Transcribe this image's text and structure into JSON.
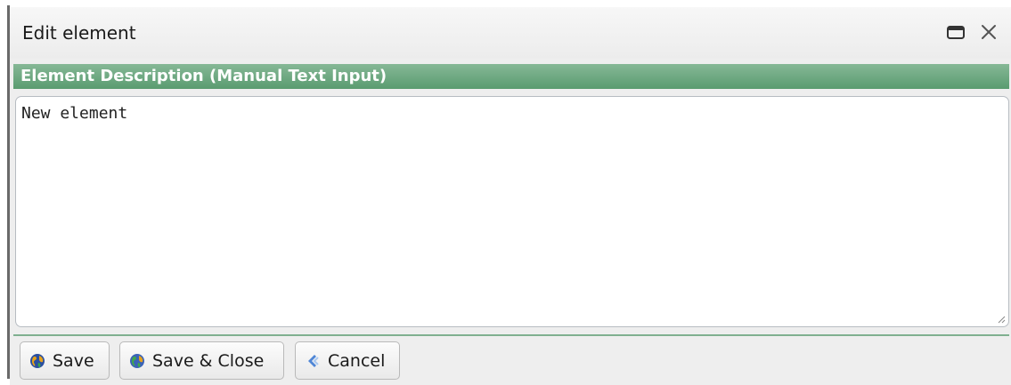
{
  "dialog": {
    "title": "Edit element",
    "maximize_icon": "maximize-icon",
    "close_icon": "close-icon"
  },
  "section": {
    "title": "Element Description (Manual Text Input)",
    "header_color": "#6aa57e"
  },
  "description": {
    "value": "New element",
    "placeholder": ""
  },
  "buttons": {
    "save_label": "Save",
    "save_icon": "save-globe-icon",
    "save_close_label": "Save & Close",
    "save_close_icon": "save-close-globe-icon",
    "cancel_label": "Cancel",
    "cancel_icon": "cancel-arrow-icon"
  }
}
